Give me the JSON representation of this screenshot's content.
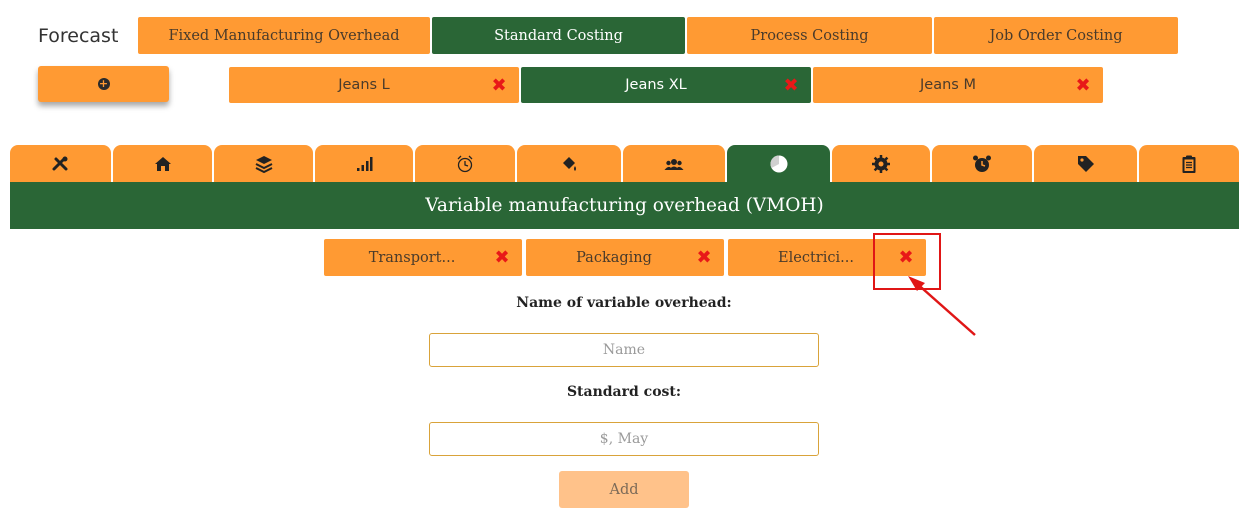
{
  "brand": "Forecast",
  "top_tabs": [
    {
      "label": "Fixed Manufacturing Overhead",
      "active": false
    },
    {
      "label": "Standard Costing",
      "active": true
    },
    {
      "label": "Process Costing",
      "active": false
    },
    {
      "label": "Job Order Costing",
      "active": false
    }
  ],
  "add_button_icon": "plus-circle-icon",
  "products": [
    {
      "label": "Jeans L",
      "active": false
    },
    {
      "label": "Jeans XL",
      "active": true
    },
    {
      "label": "Jeans M",
      "active": false
    }
  ],
  "remove_icon_glyph": "✖",
  "icon_tabs": [
    "tools-icon",
    "home-icon",
    "layers-icon",
    "signal-bars-icon",
    "alarm-outline-icon",
    "paint-bucket-icon",
    "users-icon",
    "pie-chart-icon",
    "gear-icon",
    "alarm-clock-icon",
    "tag-icon",
    "clipboard-icon"
  ],
  "active_icon_tab": "pie-chart-icon",
  "section_title": "Variable manufacturing overhead (VMOH)",
  "overheads": [
    {
      "label": "Transport..."
    },
    {
      "label": "Packaging"
    },
    {
      "label": "Electrici..."
    }
  ],
  "form": {
    "name_label": "Name of variable overhead:",
    "name_placeholder": "Name",
    "cost_label": "Standard cost:",
    "cost_placeholder": "$, May",
    "submit_label": "Add"
  },
  "colors": {
    "orange": "#ff9a33",
    "green": "#2a6636",
    "remove_red": "#e81818",
    "annotation_red": "#e01616"
  }
}
